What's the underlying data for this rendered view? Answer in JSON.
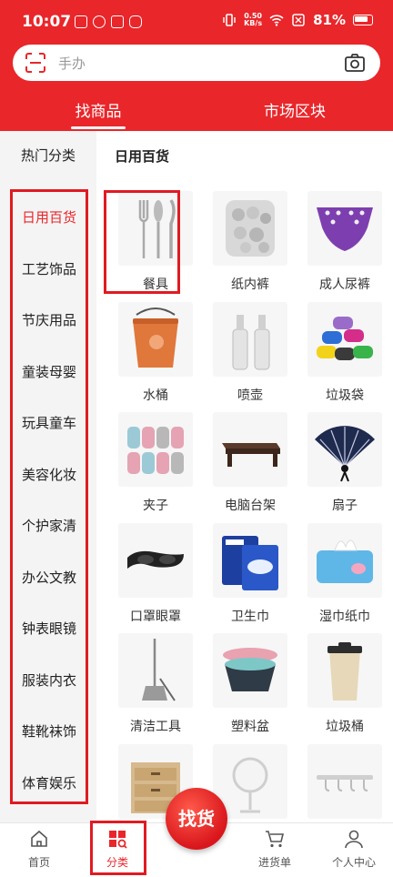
{
  "status_bar": {
    "time": "10:07",
    "net_speed_top": "0.50",
    "net_speed_bottom": "KB/s",
    "battery": "81%"
  },
  "search": {
    "placeholder": "手办"
  },
  "top_tabs": [
    {
      "label": "找商品",
      "active": true
    },
    {
      "label": "市场区块",
      "active": false
    }
  ],
  "sidebar": {
    "header": "热门分类",
    "items": [
      {
        "label": "日用百货",
        "active": true
      },
      {
        "label": "工艺饰品"
      },
      {
        "label": "节庆用品"
      },
      {
        "label": "童装母婴"
      },
      {
        "label": "玩具童车"
      },
      {
        "label": "美容化妆"
      },
      {
        "label": "个护家清"
      },
      {
        "label": "办公文教"
      },
      {
        "label": "钟表眼镜"
      },
      {
        "label": "服装内衣"
      },
      {
        "label": "鞋靴袜饰"
      },
      {
        "label": "体育娱乐"
      }
    ]
  },
  "content": {
    "title": "日用百货",
    "products": [
      {
        "label": "餐具",
        "icon": "tableware-icon"
      },
      {
        "label": "纸内裤",
        "icon": "paper-underwear-icon"
      },
      {
        "label": "成人尿裤",
        "icon": "adult-diaper-icon"
      },
      {
        "label": "水桶",
        "icon": "bucket-icon"
      },
      {
        "label": "喷壶",
        "icon": "spray-bottle-icon"
      },
      {
        "label": "垃圾袋",
        "icon": "garbage-bag-icon"
      },
      {
        "label": "夹子",
        "icon": "clip-icon"
      },
      {
        "label": "电脑台架",
        "icon": "monitor-stand-icon"
      },
      {
        "label": "扇子",
        "icon": "fan-icon"
      },
      {
        "label": "口罩眼罩",
        "icon": "eye-mask-icon"
      },
      {
        "label": "卫生巾",
        "icon": "sanitary-pad-icon"
      },
      {
        "label": "湿巾纸巾",
        "icon": "wet-wipes-icon"
      },
      {
        "label": "清洁工具",
        "icon": "cleaning-tool-icon"
      },
      {
        "label": "塑料盆",
        "icon": "plastic-basin-icon"
      },
      {
        "label": "垃圾桶",
        "icon": "trash-can-icon"
      },
      {
        "label": "",
        "icon": "drawer-box-icon"
      },
      {
        "label": "",
        "icon": "mirror-icon"
      },
      {
        "label": "",
        "icon": "hook-rack-icon"
      }
    ]
  },
  "bottom_nav": {
    "items": [
      {
        "label": "首页",
        "icon": "home-icon"
      },
      {
        "label": "分类",
        "icon": "category-icon",
        "active": true
      },
      {
        "label": "进货单",
        "icon": "cart-icon"
      },
      {
        "label": "个人中心",
        "icon": "user-icon"
      }
    ],
    "center_button": "找货"
  },
  "colors": {
    "brand_red": "#e9262a",
    "highlight_red": "#e01b22"
  }
}
